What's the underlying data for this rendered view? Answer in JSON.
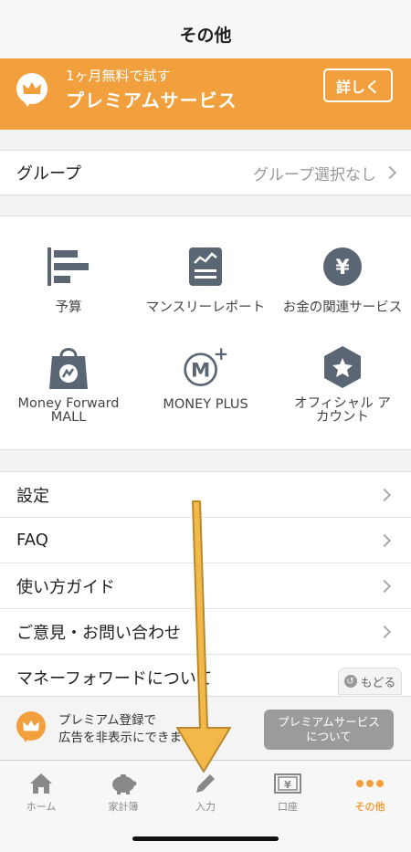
{
  "header": {
    "title": "その他"
  },
  "banner": {
    "subtitle": "1ヶ月無料で試す",
    "title": "プレミアムサービス",
    "detail_label": "詳しく",
    "color": "#f2a03e"
  },
  "group": {
    "label": "グループ",
    "value": "グループ選択なし"
  },
  "grid": [
    {
      "label": "予算",
      "icon": "budget-bars-icon"
    },
    {
      "label": "マンスリーレポート",
      "icon": "monthly-report-icon"
    },
    {
      "label": "お金の関連サービス",
      "icon": "yen-coin-icon"
    },
    {
      "label": "Money Forward MALL",
      "icon": "shopping-bag-icon"
    },
    {
      "label": "MONEY PLUS",
      "icon": "money-plus-icon"
    },
    {
      "label": "オフィシャル アカウント",
      "icon": "star-hexagon-icon"
    }
  ],
  "menu": [
    {
      "label": "設定"
    },
    {
      "label": "FAQ"
    },
    {
      "label": "使い方ガイド"
    },
    {
      "label": "ご意見・お問い合わせ"
    },
    {
      "label": "マネーフォワードについて"
    }
  ],
  "modoru": {
    "label": "もどる"
  },
  "ad": {
    "line1": "プレミアム登録で",
    "line2": "広告を非表示にできます",
    "button_line1": "プレミアムサービス",
    "button_line2": "について"
  },
  "tabs": [
    {
      "label": "ホーム",
      "icon": "home-icon"
    },
    {
      "label": "家計簿",
      "icon": "piggy-bank-icon"
    },
    {
      "label": "入力",
      "icon": "pencil-icon"
    },
    {
      "label": "口座",
      "icon": "bank-account-icon"
    },
    {
      "label": "その他",
      "icon": "more-dots-icon",
      "active": true
    }
  ]
}
